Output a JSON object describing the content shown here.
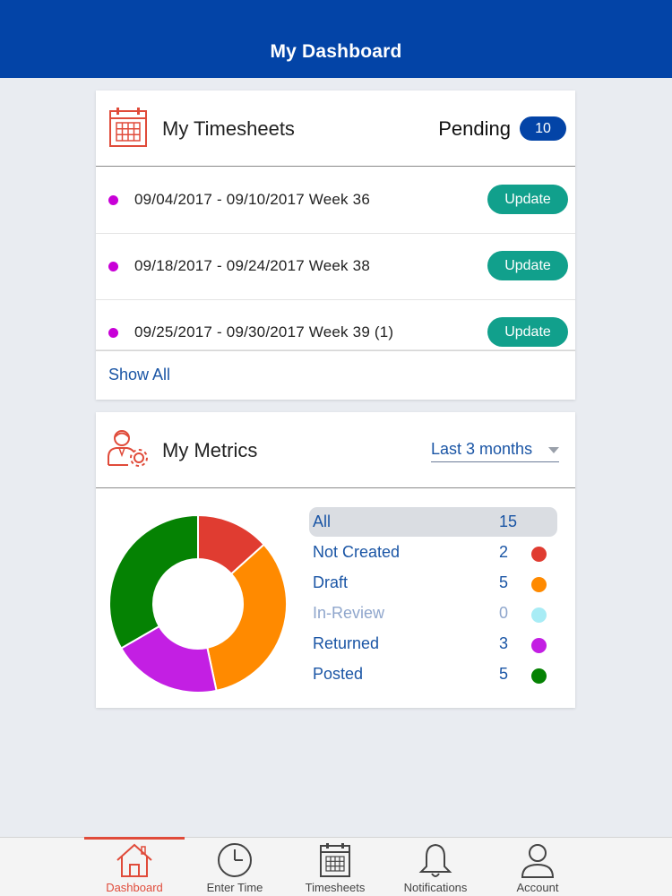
{
  "header": {
    "title": "My Dashboard"
  },
  "timesheets": {
    "title": "My Timesheets",
    "pending_label": "Pending",
    "pending_count": "10",
    "rows": [
      {
        "text": "09/04/2017 - 09/10/2017 Week 36",
        "button": "Update"
      },
      {
        "text": "09/18/2017 - 09/24/2017 Week 38",
        "button": "Update"
      },
      {
        "text": "09/25/2017 - 09/30/2017 Week 39 (1)",
        "button": "Update"
      }
    ],
    "show_all": "Show All",
    "status_dot_color": "#c800d7",
    "button_color": "#11a08c"
  },
  "metrics": {
    "title": "My Metrics",
    "range": "Last 3 months",
    "legend": [
      {
        "label": "All",
        "count": "15",
        "color": ""
      },
      {
        "label": "Not Created",
        "count": "2",
        "color": "#e03c31"
      },
      {
        "label": "Draft",
        "count": "5",
        "color": "#ff8a00"
      },
      {
        "label": "In-Review",
        "count": "0",
        "color": "#a8ecf5"
      },
      {
        "label": "Returned",
        "count": "3",
        "color": "#c31fe3"
      },
      {
        "label": "Posted",
        "count": "5",
        "color": "#058203"
      }
    ]
  },
  "chart_data": {
    "type": "pie",
    "donut": true,
    "categories": [
      "Not Created",
      "Draft",
      "In-Review",
      "Returned",
      "Posted"
    ],
    "values": [
      2,
      5,
      0,
      3,
      5
    ],
    "colors": [
      "#e03c31",
      "#ff8a00",
      "#a8ecf5",
      "#c31fe3",
      "#058203"
    ]
  },
  "tabs": [
    {
      "label": "Dashboard",
      "icon": "home-icon",
      "active": true
    },
    {
      "label": "Enter Time",
      "icon": "clock-icon",
      "active": false
    },
    {
      "label": "Timesheets",
      "icon": "calendar-icon",
      "active": false
    },
    {
      "label": "Notifications",
      "icon": "bell-icon",
      "active": false
    },
    {
      "label": "Account",
      "icon": "person-icon",
      "active": false
    }
  ],
  "colors": {
    "brand": "#0344a7",
    "accent": "#e04b3a",
    "link": "#1a55a5"
  }
}
